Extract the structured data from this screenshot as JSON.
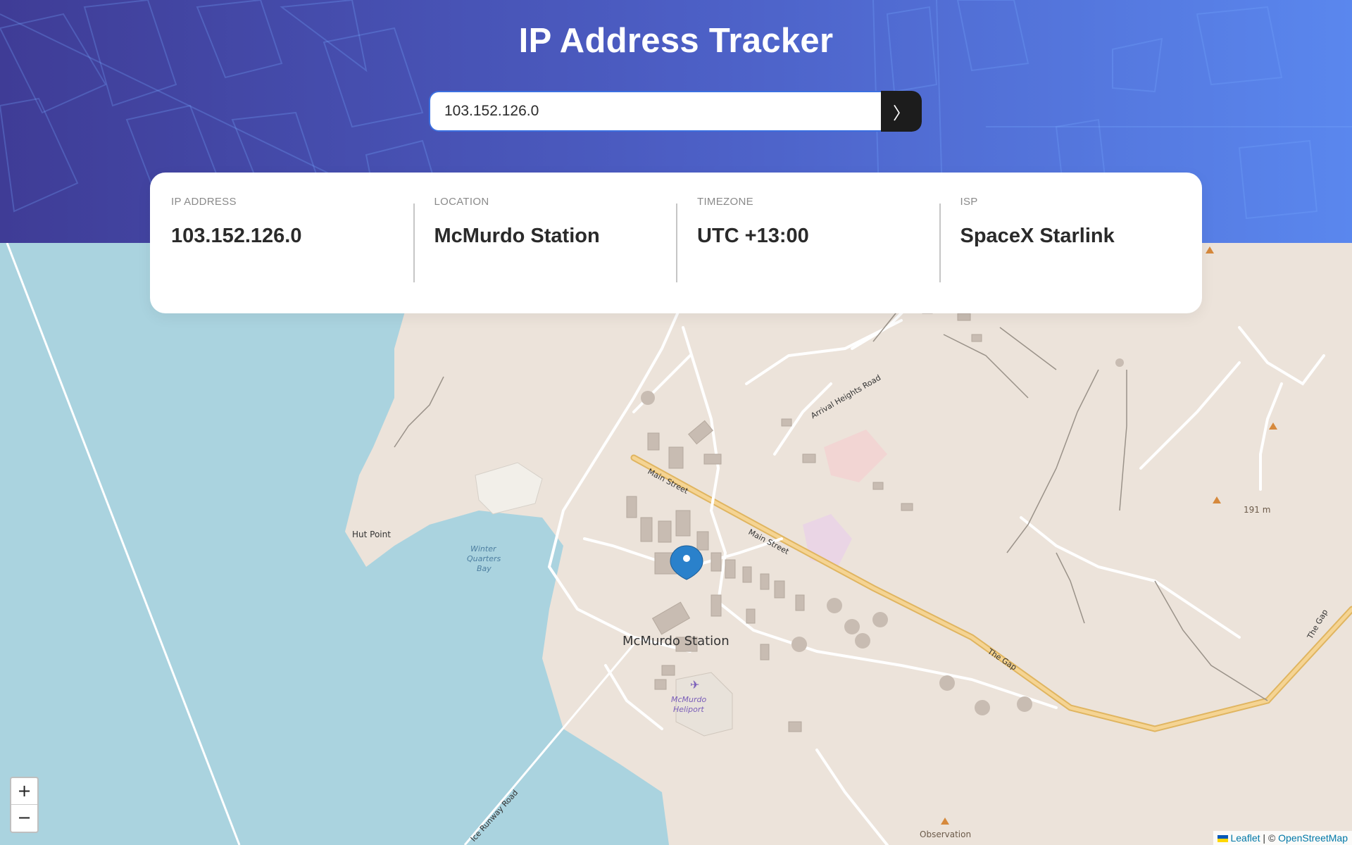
{
  "header": {
    "title": "IP Address Tracker"
  },
  "search": {
    "value": "103.152.126.0",
    "button_icon": "chevron-right-icon",
    "button_glyph": "〉"
  },
  "info": {
    "ip": {
      "label": "IP ADDRESS",
      "value": "103.152.126.0"
    },
    "location": {
      "label": "LOCATION",
      "value": "McMurdo Station"
    },
    "timezone": {
      "label": "TIMEZONE",
      "value": "UTC +13:00"
    },
    "isp": {
      "label": "ISP",
      "value": "SpaceX Starlink"
    }
  },
  "map": {
    "labels": {
      "station": "McMurdo Station",
      "hut_point": "Hut Point",
      "bay_1": "Winter",
      "bay_2": "Quarters",
      "bay_3": "Bay",
      "heliport_1": "McMurdo",
      "heliport_2": "Heliport",
      "main_street_1": "Main Street",
      "main_street_2": "Main Street",
      "arrival_heights": "Arrival Heights Road",
      "the_gap_1": "The Gap",
      "the_gap_2": "The Gap",
      "ice_runway": "Ice Runway Road",
      "elevation": "191 m",
      "observation_hill": "Observation"
    },
    "zoom_in": "+",
    "zoom_out": "−",
    "marker_icon": "map-pin-icon"
  },
  "attribution": {
    "leaflet": "Leaflet",
    "separator": "| ©",
    "osm": "OpenStreetMap"
  },
  "colors": {
    "gradient_start": "#3f3c96",
    "gradient_end": "#5a87ee",
    "water": "#aad3df",
    "land": "#ece3da",
    "road": "#f0c878",
    "marker": "#2a81cb"
  }
}
